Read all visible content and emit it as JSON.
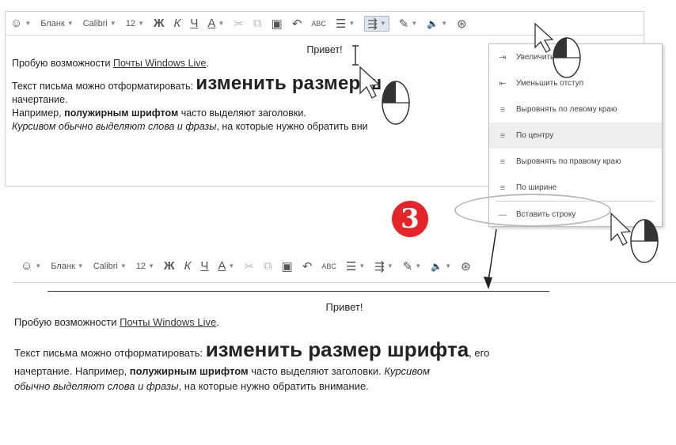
{
  "toolbar": {
    "emoji": "☺",
    "style_label": "Бланк",
    "font_label": "Calibri",
    "size_label": "12",
    "bold": "Ж",
    "italic": "К",
    "underline": "Ч",
    "font_color": "A",
    "cut": "✂",
    "copy": "⧉",
    "paste": "▣",
    "undo": "↶",
    "spell": "ABC",
    "list": "☰",
    "indent": "⇶",
    "highlight": "✎",
    "sound": "🔈",
    "link": "⊛"
  },
  "panel1": {
    "greeting": "Привет!",
    "intro_prefix": "Пробую возможности ",
    "intro_link": "Почты Windows Live",
    "intro_suffix": ".",
    "format_prefix": "Текст письма можно отформатировать: ",
    "format_big": "изменить размер ш",
    "line_nachertanie": "начертание.",
    "example_prefix": "Например, ",
    "example_bold": "полужирным шрифтом",
    "example_suffix": " часто выделяют заголовки.",
    "italic_text": "Курсивом обычно выделяют слова и фразы",
    "italic_suffix": ", на которые нужно обратить вни"
  },
  "menu": {
    "items": [
      {
        "icon": "⇥",
        "label": "Увеличить отступ"
      },
      {
        "icon": "⇤",
        "label": "Уменьшить отступ"
      },
      {
        "icon": "≡",
        "label": "Выровнять по левому краю"
      },
      {
        "icon": "≡",
        "label": "По центру"
      },
      {
        "icon": "≡",
        "label": "Выровнять по правому краю"
      },
      {
        "icon": "≡",
        "label": "По ширине"
      },
      {
        "icon": "—",
        "label": "Вставить строку"
      }
    ]
  },
  "step_badge": "3",
  "panel2": {
    "greeting": "Привет!",
    "intro_prefix": "Пробую возможности ",
    "intro_link": "Почты Windows Live",
    "intro_suffix": ".",
    "format_prefix": "Текст письма можно отформатировать: ",
    "format_big": "изменить размер шрифта",
    "format_suffix": ", его",
    "line2_prefix": "начертание. Например, ",
    "line2_bold": "полужирным шрифтом",
    "line2_suffix": " часто выделяют заголовки. ",
    "line2_italic": "Курсивом",
    "line3_italic": "обычно выделяют слова и фразы",
    "line3_suffix": ", на которые нужно обратить внимание."
  },
  "colors": {
    "badge": "#e4262b",
    "menu_highlight": "#eeeeee"
  }
}
